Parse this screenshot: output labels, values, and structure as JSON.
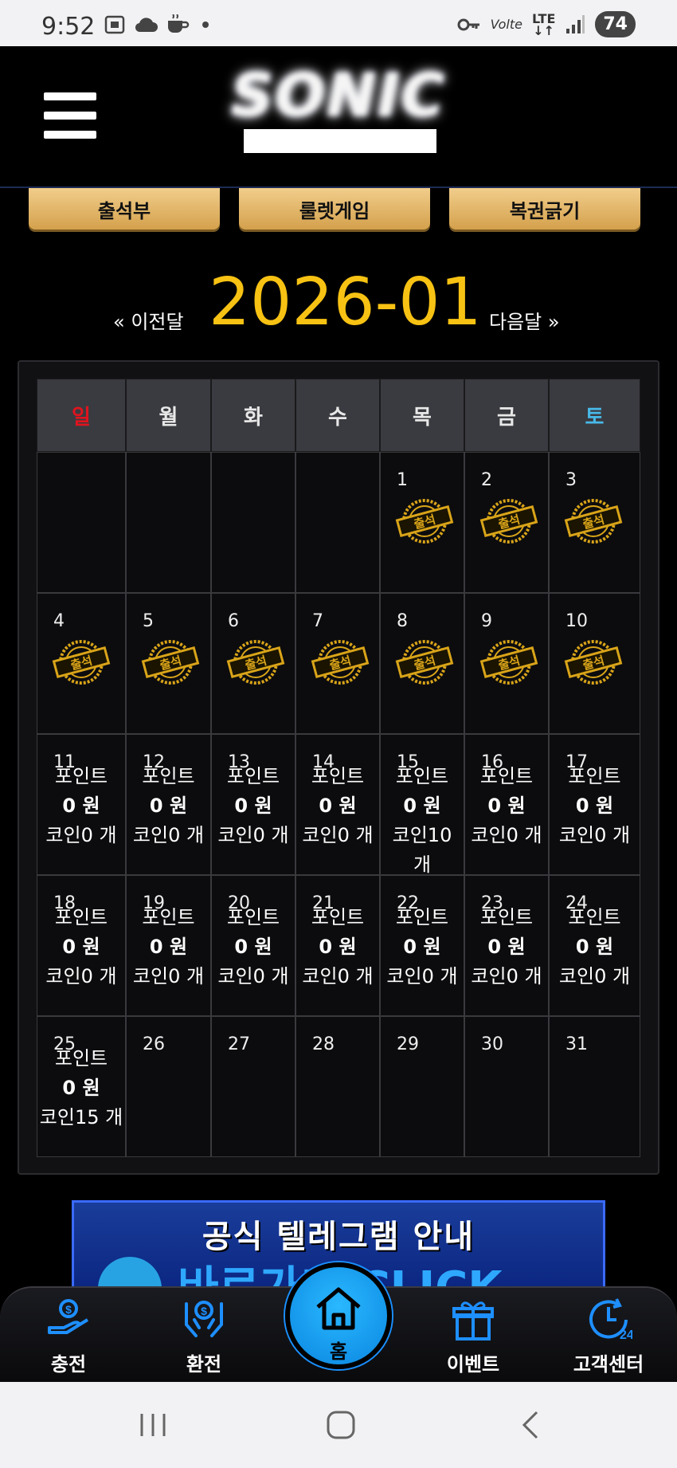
{
  "status_bar": {
    "time": "9:52",
    "battery": "74",
    "network": "LTE",
    "volte": "Volte"
  },
  "header": {
    "logo_text": "SONIC"
  },
  "tabs": [
    "출석부",
    "룰렛게임",
    "복권긁기"
  ],
  "month_nav": {
    "prev_label": "« 이전달",
    "current_month": "2026-01",
    "next_label": "다음달 »"
  },
  "calendar": {
    "weekdays": [
      "일",
      "월",
      "화",
      "수",
      "목",
      "금",
      "토"
    ],
    "stamp_label": "출석",
    "weeks": [
      [
        {
          "day": ""
        },
        {
          "day": ""
        },
        {
          "day": ""
        },
        {
          "day": ""
        },
        {
          "day": "1",
          "attended": true
        },
        {
          "day": "2",
          "attended": true
        },
        {
          "day": "3",
          "attended": true
        }
      ],
      [
        {
          "day": "4",
          "attended": true
        },
        {
          "day": "5",
          "attended": true
        },
        {
          "day": "6",
          "attended": true
        },
        {
          "day": "7",
          "attended": true
        },
        {
          "day": "8",
          "attended": true
        },
        {
          "day": "9",
          "attended": true
        },
        {
          "day": "10",
          "attended": true
        }
      ],
      [
        {
          "day": "11",
          "point_label": "포인트",
          "point": "0 원",
          "coin": "코인0 개"
        },
        {
          "day": "12",
          "point_label": "포인트",
          "point": "0 원",
          "coin": "코인0 개"
        },
        {
          "day": "13",
          "point_label": "포인트",
          "point": "0 원",
          "coin": "코인0 개"
        },
        {
          "day": "14",
          "point_label": "포인트",
          "point": "0 원",
          "coin": "코인0 개"
        },
        {
          "day": "15",
          "point_label": "포인트",
          "point": "0 원",
          "coin": "코인10 개"
        },
        {
          "day": "16",
          "point_label": "포인트",
          "point": "0 원",
          "coin": "코인0 개"
        },
        {
          "day": "17",
          "point_label": "포인트",
          "point": "0 원",
          "coin": "코인0 개"
        }
      ],
      [
        {
          "day": "18",
          "point_label": "포인트",
          "point": "0 원",
          "coin": "코인0 개"
        },
        {
          "day": "19",
          "point_label": "포인트",
          "point": "0 원",
          "coin": "코인0 개"
        },
        {
          "day": "20",
          "point_label": "포인트",
          "point": "0 원",
          "coin": "코인0 개"
        },
        {
          "day": "21",
          "point_label": "포인트",
          "point": "0 원",
          "coin": "코인0 개"
        },
        {
          "day": "22",
          "point_label": "포인트",
          "point": "0 원",
          "coin": "코인0 개"
        },
        {
          "day": "23",
          "point_label": "포인트",
          "point": "0 원",
          "coin": "코인0 개"
        },
        {
          "day": "24",
          "point_label": "포인트",
          "point": "0 원",
          "coin": "코인0 개"
        }
      ],
      [
        {
          "day": "25",
          "point_label": "포인트",
          "point": "0 원",
          "coin": "코인15 개"
        },
        {
          "day": "26"
        },
        {
          "day": "27"
        },
        {
          "day": "28"
        },
        {
          "day": "29"
        },
        {
          "day": "30"
        },
        {
          "day": "31"
        }
      ]
    ]
  },
  "banner": {
    "title": "공식 텔레그램 안내",
    "subtitle": "바로가기 CLICK"
  },
  "bottom_nav": [
    {
      "label": "충전",
      "icon": "charge-icon"
    },
    {
      "label": "환전",
      "icon": "exchange-icon"
    },
    {
      "label": "홈",
      "icon": "home-icon"
    },
    {
      "label": "이벤트",
      "icon": "gift-icon"
    },
    {
      "label": "고객센터",
      "icon": "support-24-icon"
    }
  ],
  "colors": {
    "accent_gold": "#f7c213",
    "tab_gold": "#e2b565",
    "sunday": "#e0141e",
    "saturday": "#48b9e8",
    "home_blue": "#1a9cf0"
  }
}
